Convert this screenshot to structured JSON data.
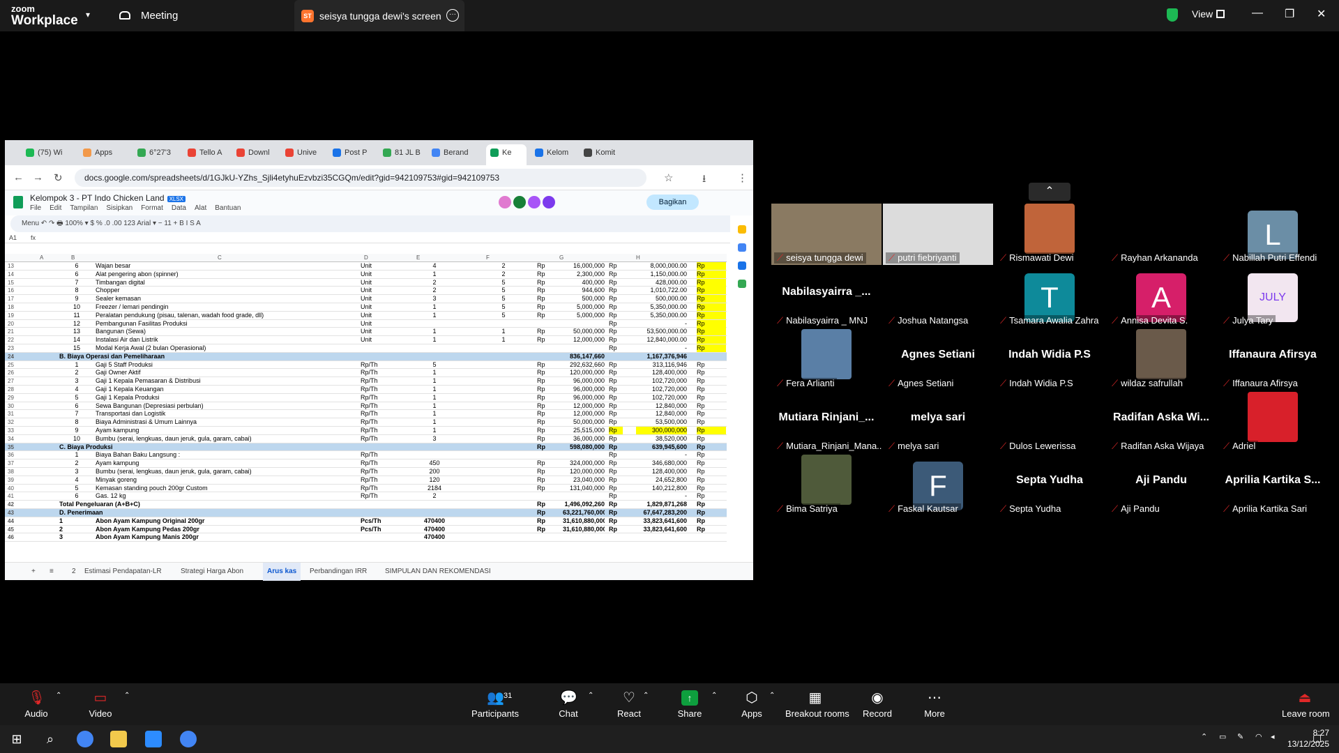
{
  "zoom": {
    "brand_line1": "zoom",
    "brand_line2": "Workplace",
    "meeting_label": "Meeting",
    "share_tab_label": "seisya tungga dewi's screen",
    "share_badge": "ST",
    "view_label": "View"
  },
  "browser": {
    "tabs": [
      "(75) Wi",
      "Apps",
      "6°27'3",
      "Tello A",
      "Downl",
      "Unive",
      "Post P",
      "81 JL B",
      "Berand",
      "Ke",
      "Kelom",
      "Komit"
    ],
    "url": "docs.google.com/spreadsheets/d/1GJkU-YZhs_Sjli4etyhuEzvbzi35CGQm/edit?gid=942109753#gid=942109753",
    "doc_title": "Kelompok 3 - PT Indo Chicken Land",
    "doc_badge": "XLSX",
    "menus": [
      "File",
      "Edit",
      "Tampilan",
      "Sisipkan",
      "Format",
      "Data",
      "Alat",
      "Bantuan"
    ],
    "share_button": "Bagikan",
    "toolbar_text": "Menu   ↶  ↷  🖶   100% ▾   $  %  .0  .00  123   Arial ▾   −  11  +   B  I  S  A",
    "cell_ref": "A1",
    "fx": "fx",
    "columns": [
      "A",
      "B",
      "C",
      "D",
      "E",
      "F",
      "G",
      "H"
    ],
    "rows": [
      {
        "n": "13",
        "b": "6",
        "c": "Wajan besar",
        "d": "Unit",
        "e": "4",
        "f": "2",
        "g1": "Rp",
        "g": "16,000,000",
        "h1": "Rp",
        "h": "8,000,000.00",
        "i": "Rp",
        "t": "y"
      },
      {
        "n": "14",
        "b": "6",
        "c": "Alat pengering abon (spinner)",
        "d": "Unit",
        "e": "1",
        "f": "2",
        "g1": "Rp",
        "g": "2,300,000",
        "h1": "Rp",
        "h": "1,150,000.00",
        "i": "Rp",
        "t": "y"
      },
      {
        "n": "15",
        "b": "7",
        "c": "Timbangan digital",
        "d": "Unit",
        "e": "2",
        "f": "5",
        "g1": "Rp",
        "g": "400,000",
        "h1": "Rp",
        "h": "428,000.00",
        "i": "Rp",
        "t": "y"
      },
      {
        "n": "16",
        "b": "8",
        "c": "Chopper",
        "d": "Unit",
        "e": "2",
        "f": "5",
        "g1": "Rp",
        "g": "944,600",
        "h1": "Rp",
        "h": "1,010,722.00",
        "i": "Rp",
        "t": "y"
      },
      {
        "n": "17",
        "b": "9",
        "c": "Sealer kemasan",
        "d": "Unit",
        "e": "3",
        "f": "5",
        "g1": "Rp",
        "g": "500,000",
        "h1": "Rp",
        "h": "500,000.00",
        "i": "Rp",
        "t": "y"
      },
      {
        "n": "18",
        "b": "10",
        "c": "Freezer / lemari pendingin",
        "d": "Unit",
        "e": "1",
        "f": "5",
        "g1": "Rp",
        "g": "5,000,000",
        "h1": "Rp",
        "h": "5,350,000.00",
        "i": "Rp",
        "t": "y"
      },
      {
        "n": "19",
        "b": "11",
        "c": "Peralatan pendukung (pisau, talenan, wadah food grade, dll)",
        "d": "Unit",
        "e": "1",
        "f": "5",
        "g1": "Rp",
        "g": "5,000,000",
        "h1": "Rp",
        "h": "5,350,000.00",
        "i": "Rp",
        "t": "y"
      },
      {
        "n": "20",
        "b": "12",
        "c": "Pembangunan Fasilitas Produksi",
        "d": "Unit",
        "e": "",
        "f": "",
        "g1": "",
        "g": "",
        "h1": "Rp",
        "h": "-",
        "i": "Rp",
        "t": "y"
      },
      {
        "n": "21",
        "b": "13",
        "c": "Bangunan (Sewa)",
        "d": "Unit",
        "e": "1",
        "f": "1",
        "g1": "Rp",
        "g": "50,000,000",
        "h1": "Rp",
        "h": "53,500,000.00",
        "i": "Rp",
        "t": "y"
      },
      {
        "n": "22",
        "b": "14",
        "c": "Instalasi Air dan Listrik",
        "d": "Unit",
        "e": "1",
        "f": "1",
        "g1": "Rp",
        "g": "12,000,000",
        "h1": "Rp",
        "h": "12,840,000.00",
        "i": "Rp",
        "t": "y"
      },
      {
        "n": "23",
        "b": "15",
        "c": "Modal Kerja Awal (2 bulan Operasional)",
        "d": "",
        "e": "",
        "f": "",
        "g1": "",
        "g": "",
        "h1": "Rp",
        "h": "-",
        "i": "Rp",
        "t": "y"
      },
      {
        "n": "24",
        "b": "B. Biaya Operasi dan Pemeliharaan",
        "c": "",
        "d": "",
        "e": "",
        "f": "",
        "g1": "",
        "g": "836,147,660",
        "h1": "",
        "h": "1,167,376,946",
        "i": "",
        "t": "sec"
      },
      {
        "n": "25",
        "b": "1",
        "c": "Gaji 5 Staff Produksi",
        "d": "Rp/Th",
        "e": "5",
        "f": "",
        "g1": "Rp",
        "g": "292,632,660",
        "h1": "Rp",
        "h": "313,116,946",
        "i": "Rp",
        "t": ""
      },
      {
        "n": "26",
        "b": "2",
        "c": "Gaji Owner Aktif",
        "d": "Rp/Th",
        "e": "1",
        "f": "",
        "g1": "Rp",
        "g": "120,000,000",
        "h1": "Rp",
        "h": "128,400,000",
        "i": "Rp",
        "t": ""
      },
      {
        "n": "27",
        "b": "3",
        "c": "Gaji 1 Kepala Pemasaran & Distribusi",
        "d": "Rp/Th",
        "e": "1",
        "f": "",
        "g1": "Rp",
        "g": "96,000,000",
        "h1": "Rp",
        "h": "102,720,000",
        "i": "Rp",
        "t": ""
      },
      {
        "n": "28",
        "b": "4",
        "c": "Gaji 1 Kepala Keuangan",
        "d": "Rp/Th",
        "e": "1",
        "f": "",
        "g1": "Rp",
        "g": "96,000,000",
        "h1": "Rp",
        "h": "102,720,000",
        "i": "Rp",
        "t": ""
      },
      {
        "n": "29",
        "b": "5",
        "c": "Gaji 1 Kepala Produksi",
        "d": "Rp/Th",
        "e": "1",
        "f": "",
        "g1": "Rp",
        "g": "96,000,000",
        "h1": "Rp",
        "h": "102,720,000",
        "i": "Rp",
        "t": ""
      },
      {
        "n": "30",
        "b": "6",
        "c": "Sewa Bangunan (Depresiasi perbulan)",
        "d": "Rp/Th",
        "e": "1",
        "f": "",
        "g1": "Rp",
        "g": "12,000,000",
        "h1": "Rp",
        "h": "12,840,000",
        "i": "Rp",
        "t": ""
      },
      {
        "n": "31",
        "b": "7",
        "c": "Transportasi dan Logistik",
        "d": "Rp/Th",
        "e": "1",
        "f": "",
        "g1": "Rp",
        "g": "12,000,000",
        "h1": "Rp",
        "h": "12,840,000",
        "i": "Rp",
        "t": ""
      },
      {
        "n": "32",
        "b": "8",
        "c": "Biaya Administrasi & Umum Lainnya",
        "d": "Rp/Th",
        "e": "1",
        "f": "",
        "g1": "Rp",
        "g": "50,000,000",
        "h1": "Rp",
        "h": "53,500,000",
        "i": "Rp",
        "t": ""
      },
      {
        "n": "33",
        "b": "9",
        "c": "Ayam kampung",
        "d": "Rp/Th",
        "e": "1",
        "f": "",
        "g1": "Rp",
        "g": "25,515,000",
        "h1": "Rp",
        "h": "300,000,000",
        "i": "Rp",
        "t": "yrow"
      },
      {
        "n": "34",
        "b": "10",
        "c": "Bumbu (serai, lengkuas, daun jeruk, gula, garam, cabai)",
        "d": "Rp/Th",
        "e": "3",
        "f": "",
        "g1": "Rp",
        "g": "36,000,000",
        "h1": "Rp",
        "h": "38,520,000",
        "i": "Rp",
        "t": ""
      },
      {
        "n": "35",
        "b": "C. Biaya Produksi",
        "c": "",
        "d": "",
        "e": "",
        "f": "",
        "g1": "Rp",
        "g": "598,080,000",
        "h1": "Rp",
        "h": "639,945,600",
        "i": "Rp",
        "t": "sec"
      },
      {
        "n": "36",
        "b": "1",
        "c": "Biaya Bahan Baku Langsung :",
        "d": "Rp/Th",
        "e": "",
        "f": "",
        "g1": "",
        "g": "",
        "h1": "Rp",
        "h": "-",
        "i": "Rp",
        "t": ""
      },
      {
        "n": "37",
        "b": "2",
        "c": "Ayam kampung",
        "d": "Rp/Th",
        "e": "450",
        "f": "",
        "g1": "Rp",
        "g": "324,000,000",
        "h1": "Rp",
        "h": "346,680,000",
        "i": "Rp",
        "t": ""
      },
      {
        "n": "38",
        "b": "3",
        "c": "Bumbu (serai, lengkuas, daun jeruk, gula, garam, cabai)",
        "d": "Rp/Th",
        "e": "200",
        "f": "",
        "g1": "Rp",
        "g": "120,000,000",
        "h1": "Rp",
        "h": "128,400,000",
        "i": "Rp",
        "t": ""
      },
      {
        "n": "39",
        "b": "4",
        "c": "Minyak goreng",
        "d": "Rp/Th",
        "e": "120",
        "f": "",
        "g1": "Rp",
        "g": "23,040,000",
        "h1": "Rp",
        "h": "24,652,800",
        "i": "Rp",
        "t": ""
      },
      {
        "n": "40",
        "b": "5",
        "c": "Kemasan standing pouch 200gr Custom",
        "d": "Rp/Th",
        "e": "2184",
        "f": "",
        "g1": "Rp",
        "g": "131,040,000",
        "h1": "Rp",
        "h": "140,212,800",
        "i": "Rp",
        "t": ""
      },
      {
        "n": "41",
        "b": "6",
        "c": "Gas. 12 kg",
        "d": "Rp/Th",
        "e": "2",
        "f": "",
        "g1": "",
        "g": "",
        "h1": "Rp",
        "h": "-",
        "i": "Rp",
        "t": ""
      },
      {
        "n": "42",
        "b": "Total Pengeluaran (A+B+C)",
        "c": "",
        "d": "",
        "e": "",
        "f": "",
        "g1": "Rp",
        "g": "1,496,092,260",
        "h1": "Rp",
        "h": "1,829,871,268",
        "i": "Rp",
        "t": "tot"
      },
      {
        "n": "43",
        "b": "D. Penerimaan",
        "c": "",
        "d": "",
        "e": "",
        "f": "",
        "g1": "Rp",
        "g": "63,221,760,000",
        "h1": "Rp",
        "h": "67,647,283,200",
        "i": "Rp",
        "t": "sec"
      },
      {
        "n": "44",
        "b": "1",
        "c": "Abon Ayam Kampung Original 200gr",
        "d": "Pcs/Th",
        "e": "470400",
        "f": "",
        "g1": "Rp",
        "g": "31,610,880,000",
        "h1": "Rp",
        "h": "33,823,641,600",
        "i": "Rp",
        "t": "tot"
      },
      {
        "n": "45",
        "b": "2",
        "c": "Abon Ayam Kampung Pedas 200gr",
        "d": "Pcs/Th",
        "e": "470400",
        "f": "",
        "g1": "Rp",
        "g": "31,610,880,000",
        "h1": "Rp",
        "h": "33,823,641,600",
        "i": "Rp",
        "t": "tot"
      },
      {
        "n": "46",
        "b": "3",
        "c": "Abon Ayam Kampung Manis 200gr",
        "d": "",
        "e": "470400",
        "f": "",
        "g1": "",
        "g": "",
        "h1": "",
        "h": "",
        "i": "",
        "t": "tot"
      }
    ],
    "sheet_tabs": [
      "Estimasi Pendapatan-LR",
      "Strategi Harga Abon",
      "Arus kas",
      "Perbandingan IRR",
      "SIMPULAN DAN REKOMENDASI"
    ],
    "sheet_tab_count": "2",
    "active_sheet": "Arus kas"
  },
  "participants": [
    {
      "label": "seisya tungga dewi",
      "big": "",
      "kind": "photo",
      "color": "#8a7a62"
    },
    {
      "label": "putri fiebriyanti",
      "big": "",
      "kind": "photo",
      "color": "#dcdcdc"
    },
    {
      "label": "Rismawati Dewi",
      "big": "",
      "kind": "photo",
      "color": "#c0643a"
    },
    {
      "label": "Rayhan Arkananda",
      "big": "",
      "kind": "black",
      "color": "#000"
    },
    {
      "label": "Nabillah Putri Effendi",
      "big": "L",
      "kind": "avatar",
      "color": "#6b8ea6"
    },
    {
      "label": "Nabilasyairra _ MNJ",
      "big": "Nabilasyairra _...",
      "kind": "name",
      "color": ""
    },
    {
      "label": "Joshua Natangsa",
      "big": "",
      "kind": "black",
      "color": "#000"
    },
    {
      "label": "Tsamara Awalia Zahra",
      "big": "T",
      "kind": "avatar",
      "color": "#0e8a9a"
    },
    {
      "label": "Annisa Devita S.",
      "big": "A",
      "kind": "avatar",
      "color": "#d61f69"
    },
    {
      "label": "Julya Tary",
      "big": "JULY",
      "kind": "avatar",
      "color": "#f2e6f0"
    },
    {
      "label": "Fera Arlianti",
      "big": "",
      "kind": "photo",
      "color": "#5a7fa6"
    },
    {
      "label": "Agnes Setiani",
      "big": "Agnes Setiani",
      "kind": "name",
      "color": ""
    },
    {
      "label": "Indah Widia P.S",
      "big": "Indah Widia P.S",
      "kind": "name",
      "color": ""
    },
    {
      "label": "wildaz safrullah",
      "big": "",
      "kind": "photo",
      "color": "#6a5a4a"
    },
    {
      "label": "Iffanaura Afirsya",
      "big": "Iffanaura Afirsya",
      "kind": "name",
      "color": ""
    },
    {
      "label": "Mutiara_Rinjani_Mana...",
      "big": "Mutiara  Rinjani_...",
      "kind": "name",
      "color": ""
    },
    {
      "label": "melya sari",
      "big": "melya sari",
      "kind": "name",
      "color": ""
    },
    {
      "label": "Dulos Lewerissa",
      "big": "",
      "kind": "black",
      "color": "#000"
    },
    {
      "label": "Radifan Aska Wijaya",
      "big": "Radifan Aska Wi...",
      "kind": "name",
      "color": ""
    },
    {
      "label": "Adriel",
      "big": "",
      "kind": "photo",
      "color": "#d8202a"
    },
    {
      "label": "Bima Satriya",
      "big": "",
      "kind": "photo",
      "color": "#4f5a3a"
    },
    {
      "label": "Faskal Kautsar",
      "big": "F",
      "kind": "avatar",
      "color": "#3c5a78"
    },
    {
      "label": "Septa Yudha",
      "big": "Septa Yudha",
      "kind": "name",
      "color": ""
    },
    {
      "label": "Aji Pandu",
      "big": "Aji Pandu",
      "kind": "name",
      "color": ""
    },
    {
      "label": "Aprilia Kartika Sari",
      "big": "Aprilia Kartika S...",
      "kind": "name",
      "color": ""
    }
  ],
  "controls": {
    "audio": "Audio",
    "video": "Video",
    "participants": "Participants",
    "participants_count": "31",
    "chat": "Chat",
    "react": "React",
    "share": "Share",
    "apps": "Apps",
    "breakout": "Breakout rooms",
    "record": "Record",
    "more": "More",
    "leave": "Leave room"
  },
  "taskbar": {
    "time": "8:27",
    "date": "13/12/2025"
  }
}
